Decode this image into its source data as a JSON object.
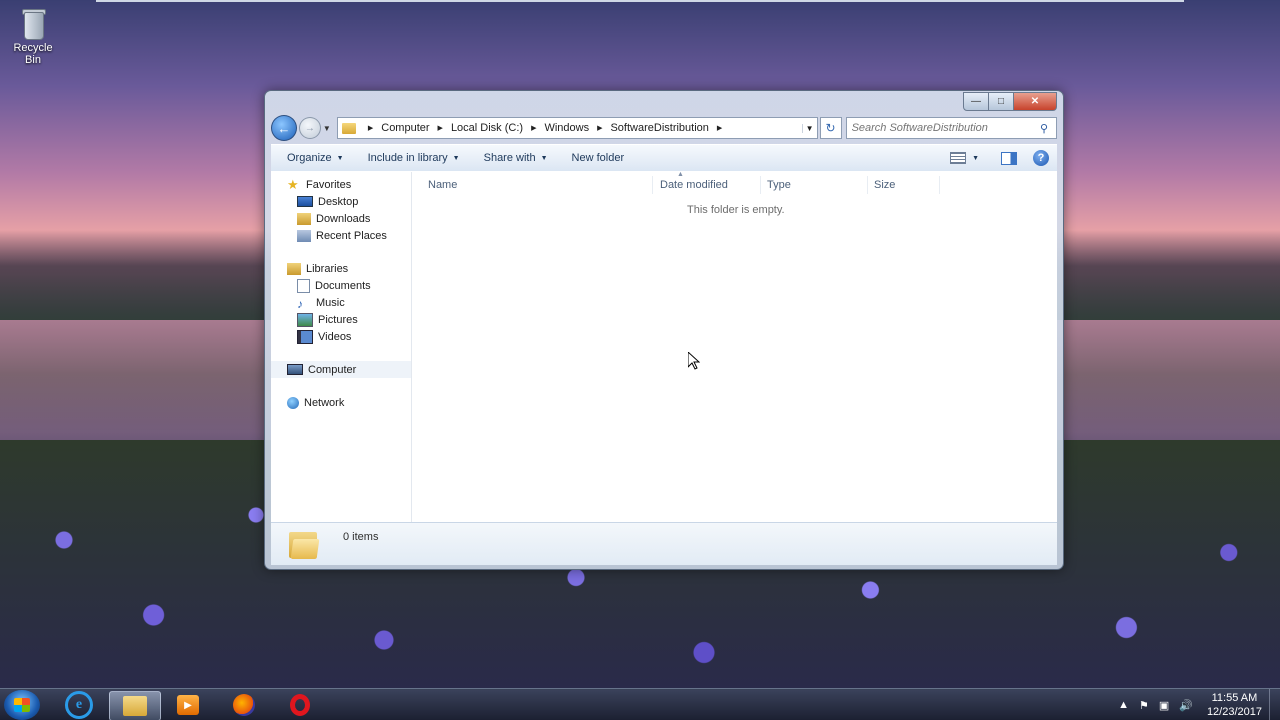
{
  "desktop": {
    "recycle_bin_label": "Recycle Bin"
  },
  "window": {
    "address": {
      "crumbs": [
        "Computer",
        "Local Disk (C:)",
        "Windows",
        "SoftwareDistribution"
      ]
    },
    "search": {
      "placeholder": "Search SoftwareDistribution"
    },
    "toolbar": {
      "organize": "Organize",
      "include_in_library": "Include in library",
      "share_with": "Share with",
      "new_folder": "New folder"
    },
    "nav_pane": {
      "favorites": "Favorites",
      "desktop": "Desktop",
      "downloads": "Downloads",
      "recent_places": "Recent Places",
      "libraries": "Libraries",
      "documents": "Documents",
      "music": "Music",
      "pictures": "Pictures",
      "videos": "Videos",
      "computer": "Computer",
      "network": "Network"
    },
    "columns": {
      "name": "Name",
      "date_modified": "Date modified",
      "type": "Type",
      "size": "Size"
    },
    "empty_message": "This folder is empty.",
    "status": {
      "item_count": "0 items"
    }
  },
  "taskbar": {
    "apps": [
      "internet-explorer",
      "windows-explorer",
      "media-player",
      "firefox",
      "opera"
    ],
    "active_app": "windows-explorer",
    "clock": {
      "time": "11:55 AM",
      "date": "12/23/2017"
    }
  },
  "colors": {
    "accent": "#1c5fb8",
    "toolbar_text": "#1e395b",
    "close_button": "#c7432c"
  }
}
